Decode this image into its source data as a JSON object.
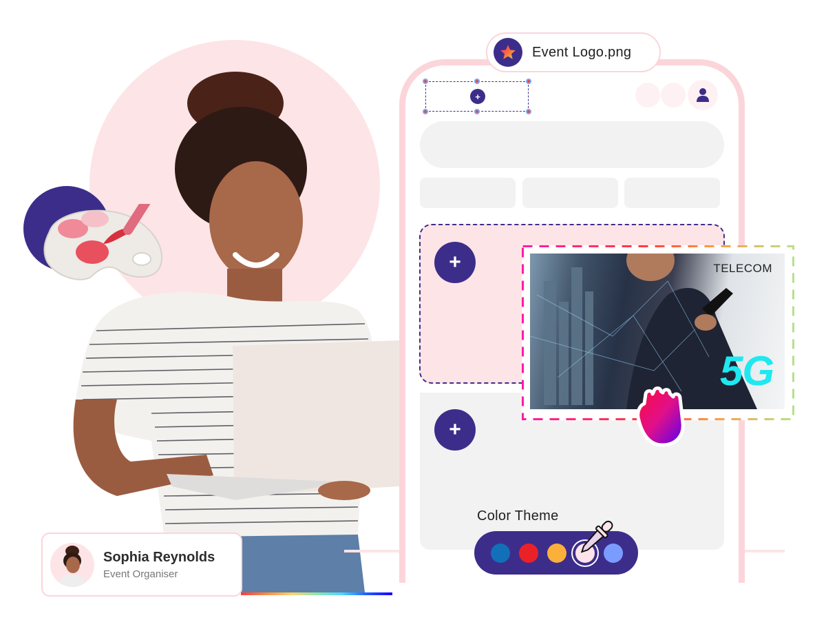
{
  "file_chip": {
    "icon": "star-icon",
    "filename": "Event Logo.png"
  },
  "phone_mockup": {
    "logo_placeholder": {
      "add_icon": "plus-icon",
      "add_label": "+"
    },
    "header_icons": [
      "circle-placeholder",
      "circle-placeholder",
      "user-icon"
    ],
    "banner_slot": {
      "add_label": "+"
    },
    "content_slot": {
      "add_label": "+"
    }
  },
  "dragged_image": {
    "headline": "TELECOM",
    "big_text": "5G",
    "cursor_icon": "grab-hand-icon"
  },
  "color_theme": {
    "label": "Color Theme",
    "swatches": [
      {
        "name": "blue",
        "color": "#1170b8"
      },
      {
        "name": "red",
        "color": "#ea2227"
      },
      {
        "name": "orange",
        "color": "#fbb03b"
      },
      {
        "name": "light-pink",
        "color": "#fde4ea",
        "selected": true
      },
      {
        "name": "periwinkle",
        "color": "#7b9cff"
      }
    ],
    "tool_icon": "eyedropper-icon"
  },
  "profile": {
    "name": "Sophia Reynolds",
    "role": "Event Organiser"
  },
  "colors": {
    "brand_purple": "#3d2d8a",
    "soft_pink": "#fde4e7",
    "border_pink": "#fbd5da",
    "placeholder_gray": "#f2f2f2"
  }
}
